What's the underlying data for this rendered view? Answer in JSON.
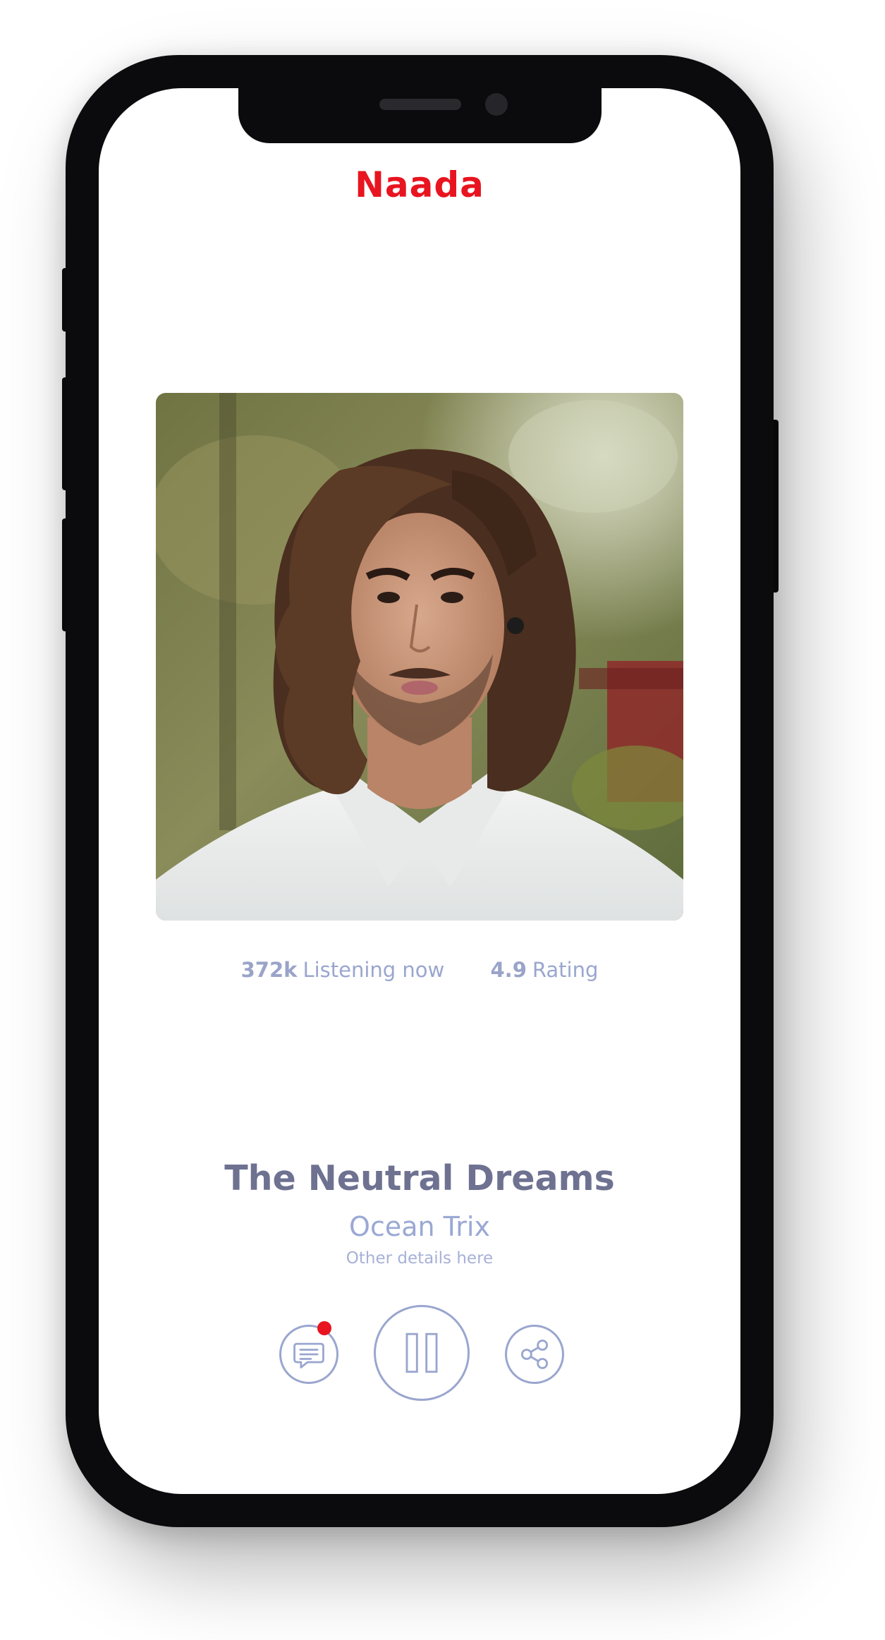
{
  "app": {
    "title": "Naada",
    "brand_color": "#e8141f"
  },
  "now_playing": {
    "cover_alt": "Artist portrait",
    "stats": [
      {
        "value": "372k",
        "label": "Listening now"
      },
      {
        "value": "4.9",
        "label": "Rating"
      }
    ],
    "title": "The Neutral Dreams",
    "artist": "Ocean Trix",
    "details": "Other details here"
  },
  "controls": {
    "comment_icon": "comment-icon",
    "comment_has_notification": true,
    "pause_icon": "pause-icon",
    "share_icon": "share-icon",
    "accent_color": "#9aa6cf"
  }
}
